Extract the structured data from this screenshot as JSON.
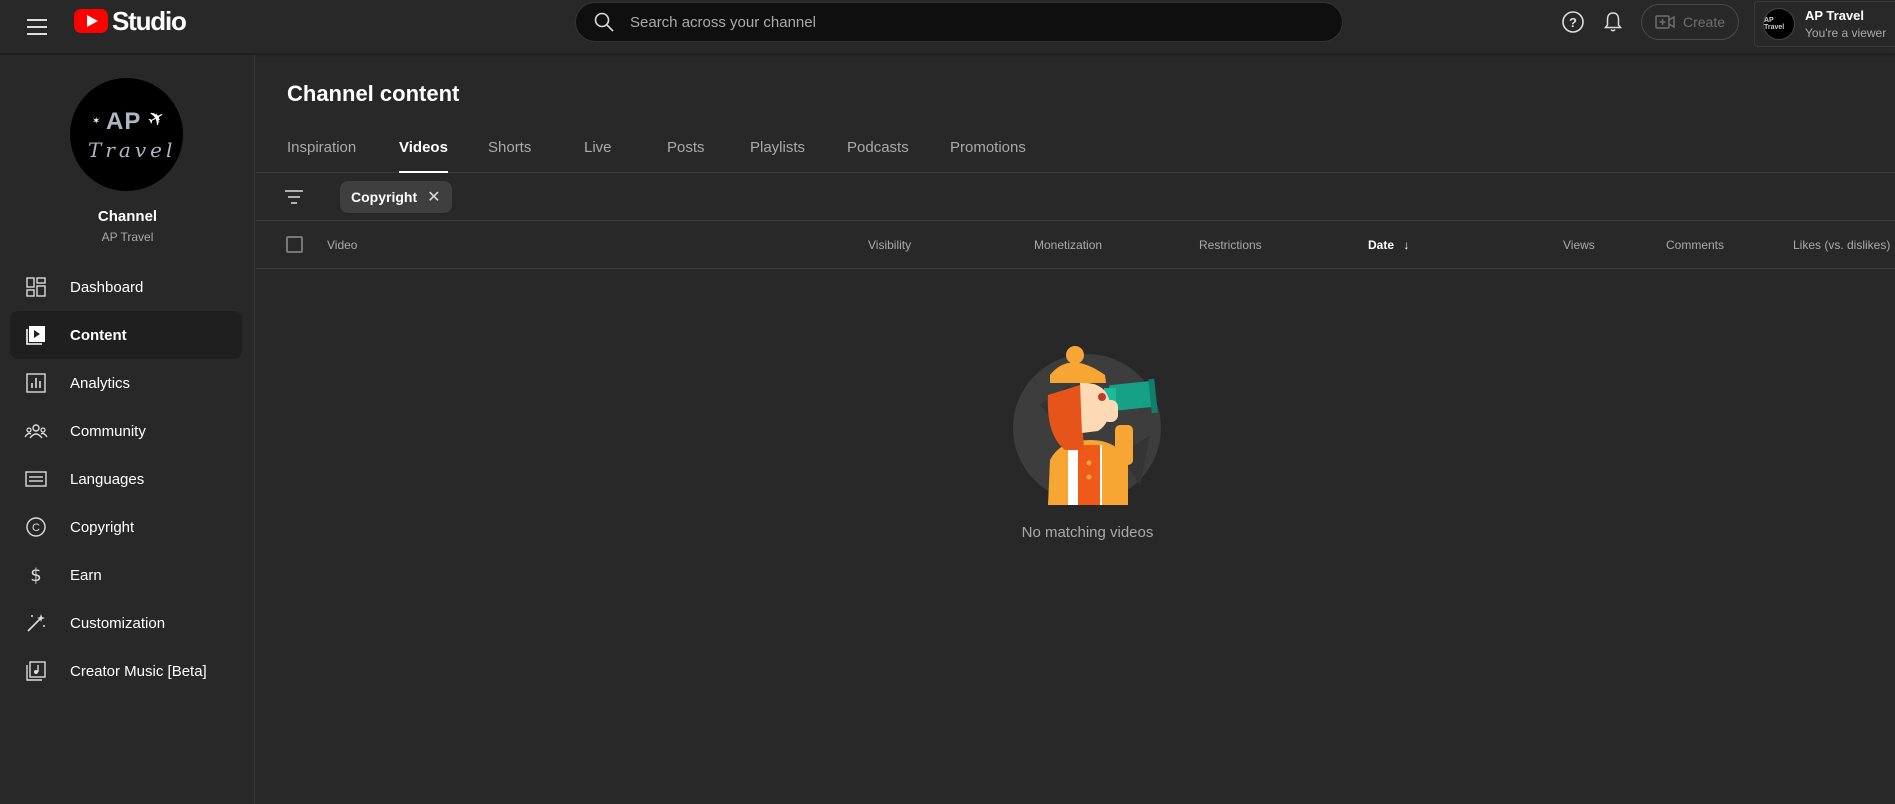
{
  "header": {
    "logo_text": "Studio",
    "search_placeholder": "Search across your channel",
    "create_label": "Create",
    "account_name": "AP Travel",
    "account_role": "You're a viewer",
    "account_avatar_text": "AP Travel"
  },
  "sidebar": {
    "avatar_text_top": "AP",
    "avatar_text_bottom": "Travel",
    "channel_title": "Channel",
    "channel_name": "AP Travel",
    "items": [
      {
        "label": "Dashboard",
        "icon": "dashboard-icon"
      },
      {
        "label": "Content",
        "icon": "content-icon",
        "active": true
      },
      {
        "label": "Analytics",
        "icon": "analytics-icon"
      },
      {
        "label": "Community",
        "icon": "community-icon"
      },
      {
        "label": "Languages",
        "icon": "languages-icon"
      },
      {
        "label": "Copyright",
        "icon": "copyright-icon"
      },
      {
        "label": "Earn",
        "icon": "earn-icon"
      },
      {
        "label": "Customization",
        "icon": "customization-icon"
      },
      {
        "label": "Creator Music [Beta]",
        "icon": "creator-music-icon"
      }
    ]
  },
  "main": {
    "title": "Channel content",
    "tabs": [
      {
        "label": "Inspiration"
      },
      {
        "label": "Videos",
        "active": true
      },
      {
        "label": "Shorts"
      },
      {
        "label": "Live"
      },
      {
        "label": "Posts"
      },
      {
        "label": "Playlists"
      },
      {
        "label": "Podcasts"
      },
      {
        "label": "Promotions"
      }
    ],
    "filter_chip": "Copyright",
    "columns": {
      "video": "Video",
      "visibility": "Visibility",
      "monetization": "Monetization",
      "restrictions": "Restrictions",
      "date": "Date",
      "views": "Views",
      "comments": "Comments",
      "likes": "Likes (vs. dislikes)"
    },
    "empty_message": "No matching videos"
  },
  "colors": {
    "background": "#282828",
    "brand_red": "#ff0000",
    "search_bg": "#0f0f0f",
    "chip_bg": "#3f3f3f"
  }
}
